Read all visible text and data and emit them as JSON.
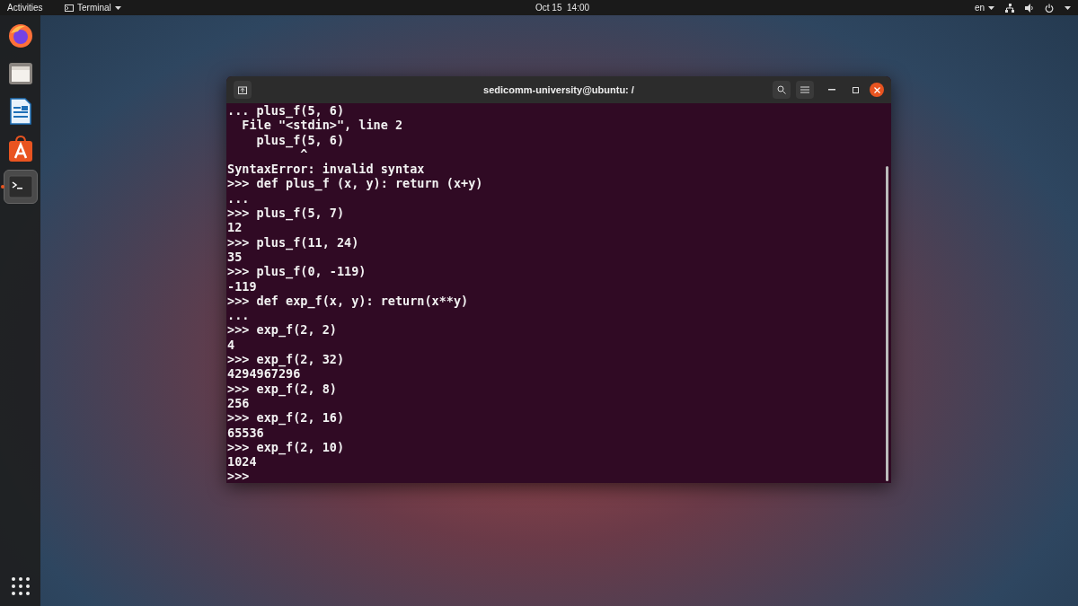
{
  "top_bar": {
    "activities": "Activities",
    "app_menu": "Terminal",
    "clock": "Oct 15  14:00",
    "language": "en"
  },
  "dock": {
    "items": [
      {
        "kind": "browser",
        "selected": false,
        "running": false
      },
      {
        "kind": "files",
        "selected": false,
        "running": false
      },
      {
        "kind": "writer",
        "selected": false,
        "running": false
      },
      {
        "kind": "store",
        "selected": false,
        "running": false
      },
      {
        "kind": "terminal",
        "selected": true,
        "running": true
      }
    ]
  },
  "terminal": {
    "title": "sedicomm-university@ubuntu: /",
    "lines": [
      "... plus_f(5, 6)",
      "  File \"<stdin>\", line 2",
      "    plus_f(5, 6)",
      "          ^",
      "SyntaxError: invalid syntax",
      ">>> def plus_f (x, y): return (x+y)",
      "...",
      ">>> plus_f(5, 7)",
      "12",
      ">>> plus_f(11, 24)",
      "35",
      ">>> plus_f(0, -119)",
      "-119",
      ">>> def exp_f(x, y): return(x**y)",
      "...",
      ">>> exp_f(2, 2)",
      "4",
      ">>> exp_f(2, 32)",
      "4294967296",
      ">>> exp_f(2, 8)",
      "256",
      ">>> exp_f(2, 16)",
      "65536",
      ">>> exp_f(2, 10)",
      "1024",
      ">>>"
    ]
  }
}
